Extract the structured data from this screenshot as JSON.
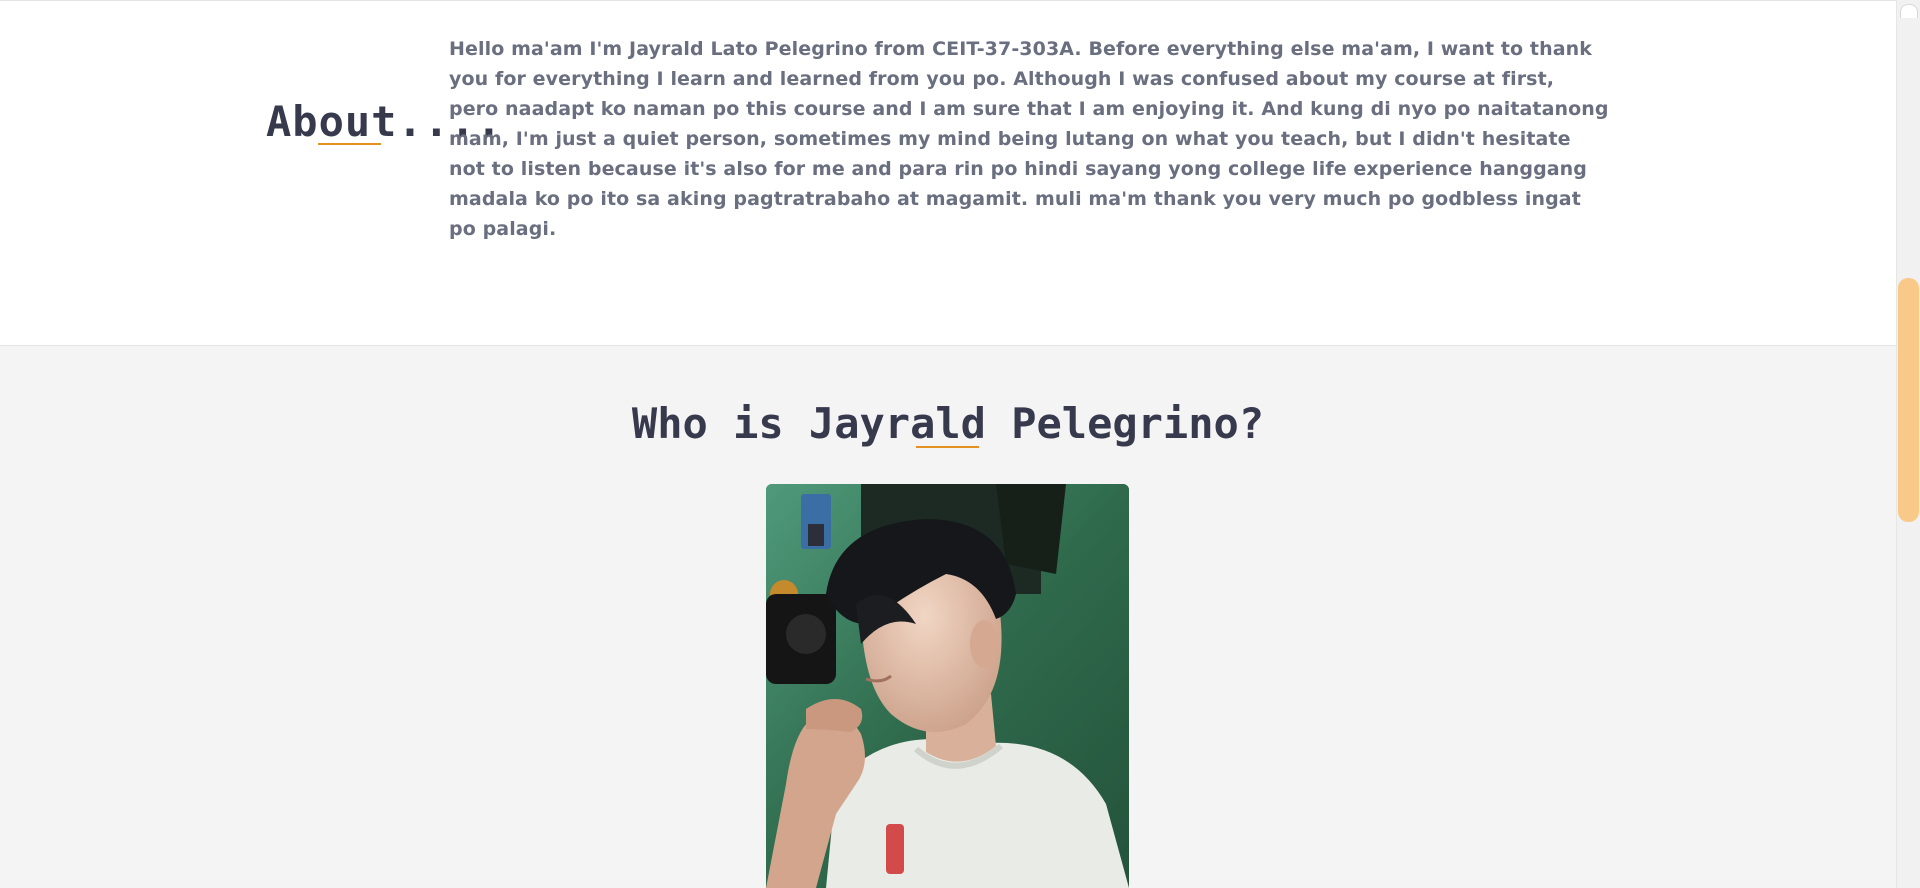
{
  "about": {
    "heading": "About....",
    "paragraph": "Hello ma'am I'm Jayrald Lato Pelegrino from CEIT-37-303A. Before everything else ma'am, I want to thank you for everything I learn and learned from you po. Although I was confused about my course at first, pero naadapt ko naman po this course and I am sure that I am enjoying it. And kung di nyo po naitatanong mam, I'm just a quiet person, sometimes my mind being lutang on what you teach, but I didn't hesitate not to listen because it's also for me and para rin po hindi sayang yong college life experience hanggang madala ko po ito sa aking pagtratrabaho at magamit. muli ma'm thank you very much po godbless ingat po palagi."
  },
  "who": {
    "heading": "Who is Jayrald Pelegrino?",
    "photo_icon": "portrait-photo"
  },
  "colors": {
    "accent": "#e39122",
    "heading": "#37394d",
    "body_text": "#6a6f80",
    "section_bg": "#f4f4f4",
    "scroll_thumb": "#f9c98a"
  },
  "scroll": {
    "position_fraction": 0.31
  }
}
